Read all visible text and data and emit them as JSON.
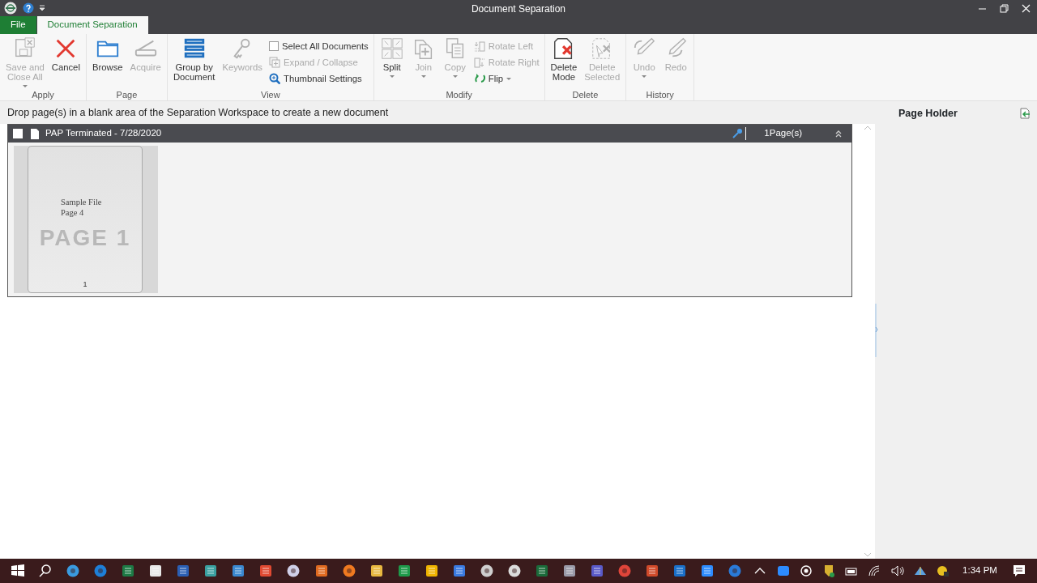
{
  "window": {
    "title": "Document Separation"
  },
  "ribbon_tabs": [
    {
      "label": "File",
      "kind": "file",
      "selected": false
    },
    {
      "label": "Document Separation",
      "kind": "tab",
      "selected": true
    }
  ],
  "ribbon_groups": [
    {
      "label": "Apply",
      "items": [
        {
          "kind": "large",
          "lines": [
            "Save and",
            "Close All"
          ],
          "disabled": true,
          "dropdown": true
        },
        {
          "kind": "large",
          "lines": [
            "Cancel"
          ],
          "disabled": false,
          "dropdown": false
        }
      ]
    },
    {
      "label": "Page",
      "items": [
        {
          "kind": "large",
          "lines": [
            "Browse"
          ],
          "disabled": false,
          "dropdown": false
        },
        {
          "kind": "large",
          "lines": [
            "Acquire"
          ],
          "disabled": true,
          "dropdown": false
        }
      ]
    },
    {
      "label": "View",
      "items": [
        {
          "kind": "large",
          "lines": [
            "Group by",
            "Document"
          ],
          "disabled": false,
          "dropdown": false
        },
        {
          "kind": "large",
          "lines": [
            "Keywords"
          ],
          "disabled": true,
          "dropdown": false
        },
        {
          "kind": "check",
          "label": "Select All Documents",
          "checked": false,
          "disabled": false
        },
        {
          "kind": "small",
          "label": "Expand / Collapse",
          "disabled": true,
          "dropdown": false
        },
        {
          "kind": "small",
          "label": "Thumbnail Settings",
          "disabled": false,
          "dropdown": false
        }
      ]
    },
    {
      "label": "Modify",
      "items": [
        {
          "kind": "large",
          "lines": [
            "Split"
          ],
          "disabled": false,
          "dropdown": true
        },
        {
          "kind": "large",
          "lines": [
            "Join"
          ],
          "disabled": true,
          "dropdown": true
        },
        {
          "kind": "large",
          "lines": [
            "Copy"
          ],
          "disabled": true,
          "dropdown": true
        },
        {
          "kind": "small",
          "label": "Rotate Left",
          "disabled": true,
          "dropdown": false
        },
        {
          "kind": "small",
          "label": "Rotate Right",
          "disabled": true,
          "dropdown": false
        },
        {
          "kind": "small",
          "label": "Flip",
          "disabled": false,
          "dropdown": true
        }
      ]
    },
    {
      "label": "Delete",
      "items": [
        {
          "kind": "large",
          "lines": [
            "Delete",
            "Mode"
          ],
          "disabled": false,
          "dropdown": false
        },
        {
          "kind": "large",
          "lines": [
            "Delete",
            "Selected"
          ],
          "disabled": true,
          "dropdown": false
        }
      ]
    },
    {
      "label": "History",
      "items": [
        {
          "kind": "large",
          "lines": [
            "Undo"
          ],
          "disabled": true,
          "dropdown": true
        },
        {
          "kind": "large",
          "lines": [
            "Redo"
          ],
          "disabled": true,
          "dropdown": false
        }
      ]
    }
  ],
  "instruction": "Drop page(s) in a blank area of the Separation Workspace to create a new document",
  "documents": [
    {
      "title": "PAP Terminated - 7/28/2020",
      "pages": "1Page(s)",
      "checked": false,
      "expanded": true,
      "thumbnails": [
        {
          "lines": [
            "Sample File",
            "Page 4"
          ],
          "watermark": "PAGE 1",
          "number": "1"
        }
      ]
    }
  ],
  "page_holder": {
    "title": "Page Holder"
  },
  "taskbar": {
    "time": "1:34 PM"
  }
}
